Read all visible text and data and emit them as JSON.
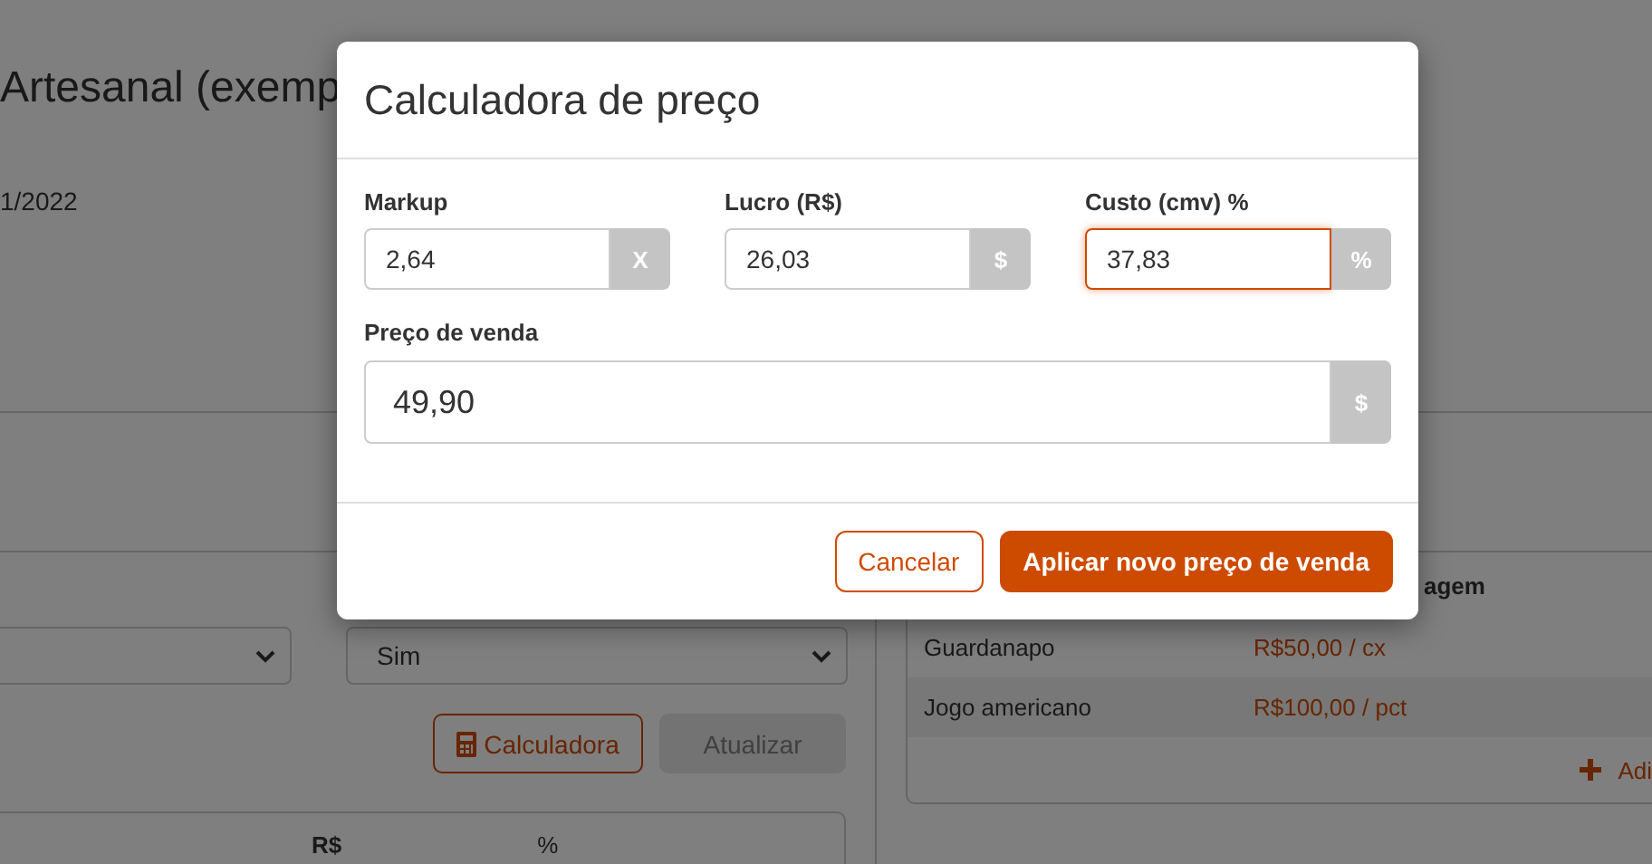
{
  "page": {
    "title": "Artesanal (exemp",
    "date": "1/2022"
  },
  "selects": [
    {
      "value": "Sim"
    }
  ],
  "actions": [
    {
      "label": "Calculadora",
      "kind": "outline",
      "disabled": false
    },
    {
      "label": "Atualizar",
      "kind": "solid",
      "disabled": true
    }
  ],
  "summary_table": {
    "columns": [
      "R$",
      "%"
    ]
  },
  "packaging": {
    "column": "agem",
    "rows": [
      {
        "name": "Guardanapo",
        "price": "R$50,00 / cx"
      },
      {
        "name": "Jogo americano",
        "price": "R$100,00 / pct"
      }
    ],
    "add_link": "Adi"
  },
  "modal": {
    "title": "Calculadora de preço",
    "fields": [
      {
        "label": "Markup",
        "value": "2,64",
        "addon": "X",
        "focused": false
      },
      {
        "label": "Lucro (R$)",
        "value": "26,03",
        "addon": "$",
        "focused": false
      },
      {
        "label": "Custo (cmv) %",
        "value": "37,83",
        "addon": "%",
        "focused": true
      }
    ],
    "sale_price": {
      "label": "Preço de venda",
      "value": "49,90",
      "addon": "$"
    },
    "buttons": [
      {
        "label": "Cancelar",
        "kind": "secondary"
      },
      {
        "label": "Aplicar novo preço de venda",
        "kind": "primary"
      }
    ]
  }
}
